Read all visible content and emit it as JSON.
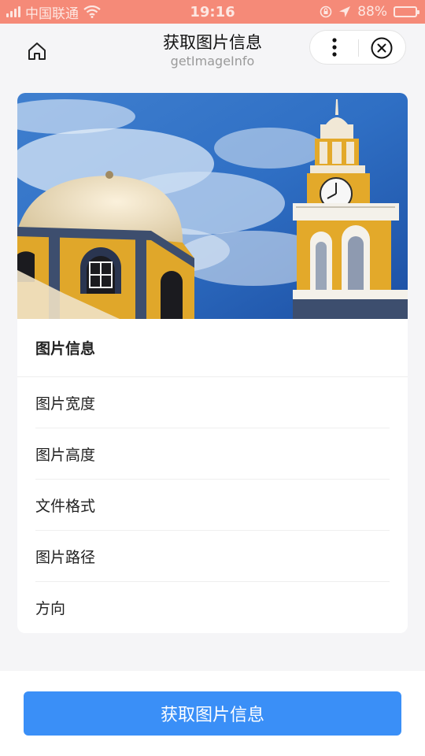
{
  "status_bar": {
    "carrier": "中国联通",
    "time": "19:16",
    "battery_percent": "88%",
    "battery_level": 0.88
  },
  "nav": {
    "title": "获取图片信息",
    "subtitle": "getImageInfo"
  },
  "info": {
    "header": "图片信息",
    "rows": [
      "图片宽度",
      "图片高度",
      "文件格式",
      "图片路径",
      "方向"
    ]
  },
  "action": {
    "label": "获取图片信息",
    "color": "#3a8ff7"
  },
  "colors": {
    "status_bar": "#f58a78",
    "page_background": "#f5f5f7"
  }
}
